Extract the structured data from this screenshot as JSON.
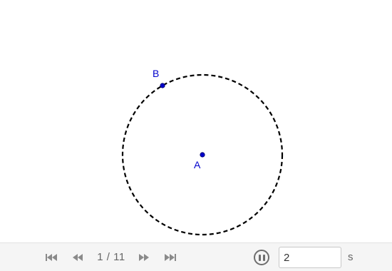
{
  "canvas": {
    "circle_style": "dashed",
    "point_color": "#0000cc",
    "point_a": {
      "label": "A"
    },
    "point_b": {
      "label": "B"
    }
  },
  "toolbar": {
    "step_indicator": "1 / 11",
    "speed_value": "2",
    "speed_unit": "s",
    "icons": [
      "skip-to-start-icon",
      "step-back-icon",
      "step-forward-icon",
      "skip-to-end-icon",
      "pause-icon"
    ],
    "icon_color": "#8a8a8a"
  }
}
